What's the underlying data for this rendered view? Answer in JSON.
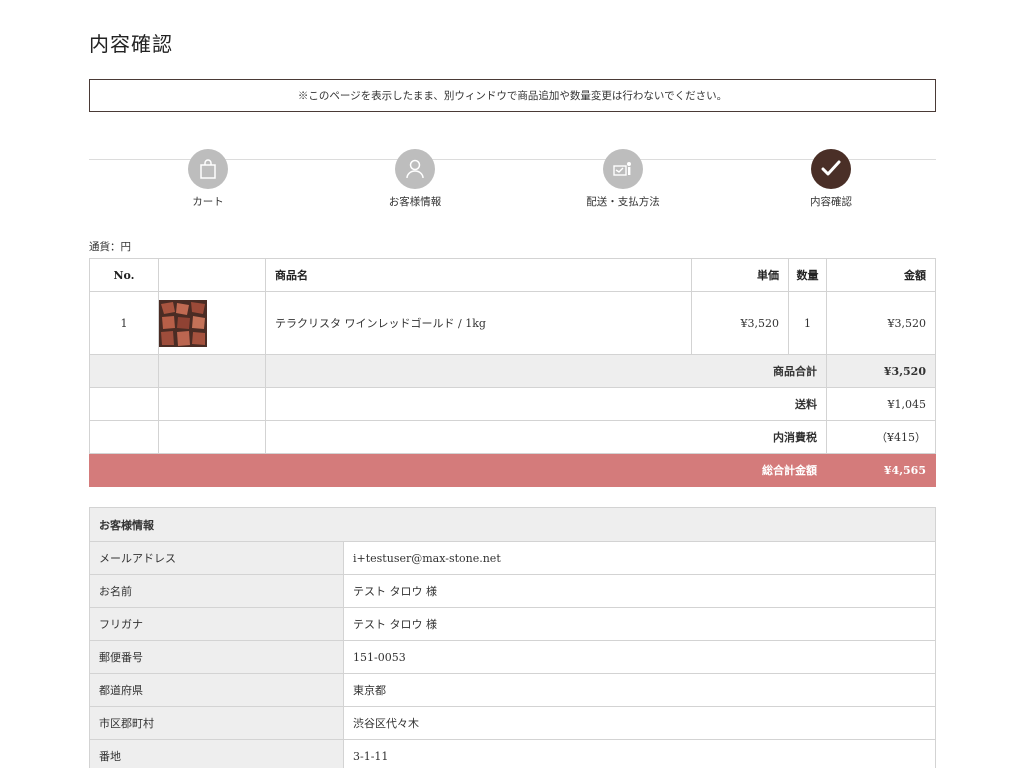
{
  "page": {
    "title": "内容確認",
    "notice": "※このページを表示したまま、別ウィンドウで商品追加や数量変更は行わないでください。"
  },
  "steps": [
    {
      "label": "カート",
      "icon": "shopping-bag-icon",
      "active": false
    },
    {
      "label": "お客様情報",
      "icon": "user-icon",
      "active": false
    },
    {
      "label": "配送・支払方法",
      "icon": "delivery-payment-icon",
      "active": false
    },
    {
      "label": "内容確認",
      "icon": "check-icon",
      "active": true
    }
  ],
  "currency": "通貨：円",
  "order": {
    "headers": {
      "no": "No.",
      "name": "商品名",
      "price": "単価",
      "qty": "数量",
      "amount": "金額"
    },
    "items": [
      {
        "no": "1",
        "name": "テラクリスタ ワインレッドゴールド / 1kg",
        "price": "¥3,520",
        "qty": "1",
        "amount": "¥3,520"
      }
    ],
    "subtotal": {
      "label": "商品合計",
      "value": "¥3,520"
    },
    "shipping": {
      "label": "送料",
      "value": "¥1,045"
    },
    "tax": {
      "label": "内消費税",
      "value": "（¥415）"
    },
    "total": {
      "label": "総合計金額",
      "value": "¥4,565"
    }
  },
  "customer": {
    "heading": "お客様情報",
    "rows": [
      {
        "label": "メールアドレス",
        "value": "i+testuser@max-stone.net"
      },
      {
        "label": "お名前",
        "value": "テスト タロウ 様"
      },
      {
        "label": "フリガナ",
        "value": "テスト タロウ 様"
      },
      {
        "label": "郵便番号",
        "value": "151-0053"
      },
      {
        "label": "都道府県",
        "value": "東京都"
      },
      {
        "label": "市区郡町村",
        "value": "渋谷区代々木"
      },
      {
        "label": "番地",
        "value": "3-1-11"
      }
    ]
  },
  "colors": {
    "accent_total": "#d47b7b",
    "active_step": "#4a2f27",
    "inactive_step": "#bdbdbd"
  }
}
